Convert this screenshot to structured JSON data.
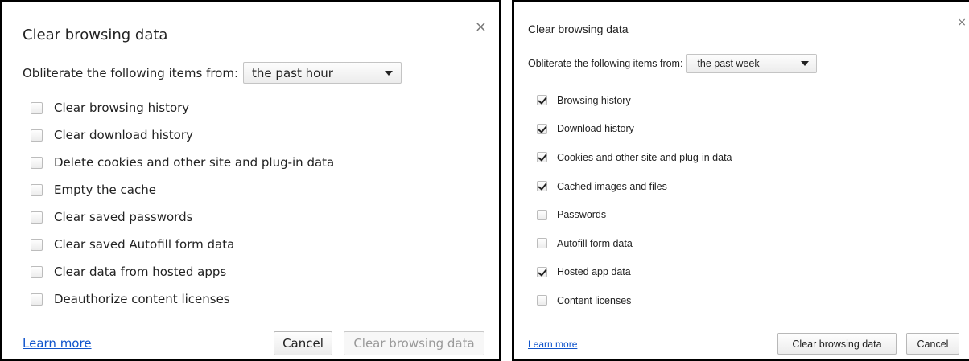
{
  "left": {
    "title": "Clear browsing data",
    "close_glyph": "×",
    "range_label": "Obliterate the following items from:",
    "range_value": "the past hour",
    "items": [
      {
        "label": "Clear browsing history",
        "checked": false
      },
      {
        "label": "Clear download history",
        "checked": false
      },
      {
        "label": "Delete cookies and other site and plug-in data",
        "checked": false
      },
      {
        "label": "Empty the cache",
        "checked": false
      },
      {
        "label": "Clear saved passwords",
        "checked": false
      },
      {
        "label": "Clear saved Autofill form data",
        "checked": false
      },
      {
        "label": "Clear data from hosted apps",
        "checked": false
      },
      {
        "label": "Deauthorize content licenses",
        "checked": false
      }
    ],
    "learn_more": "Learn more",
    "cancel_label": "Cancel",
    "clear_label": "Clear browsing data",
    "clear_disabled": true
  },
  "right": {
    "title": "Clear browsing data",
    "close_glyph": "×",
    "range_label": "Obliterate the following items from:",
    "range_value": "the past week",
    "items": [
      {
        "label": "Browsing history",
        "checked": true
      },
      {
        "label": "Download history",
        "checked": true
      },
      {
        "label": "Cookies and other site and plug-in data",
        "checked": true
      },
      {
        "label": "Cached images and files",
        "checked": true
      },
      {
        "label": "Passwords",
        "checked": false
      },
      {
        "label": "Autofill form data",
        "checked": false
      },
      {
        "label": "Hosted app data",
        "checked": true
      },
      {
        "label": "Content licenses",
        "checked": false
      }
    ],
    "learn_more": "Learn more",
    "clear_label": "Clear browsing data",
    "cancel_label": "Cancel"
  },
  "colors": {
    "link": "#1155cc",
    "border": "#000000",
    "disabled_text": "#9a9a9a"
  },
  "icons": {
    "close": "close-icon",
    "dropdown": "chevron-down-icon",
    "check": "check-icon"
  }
}
